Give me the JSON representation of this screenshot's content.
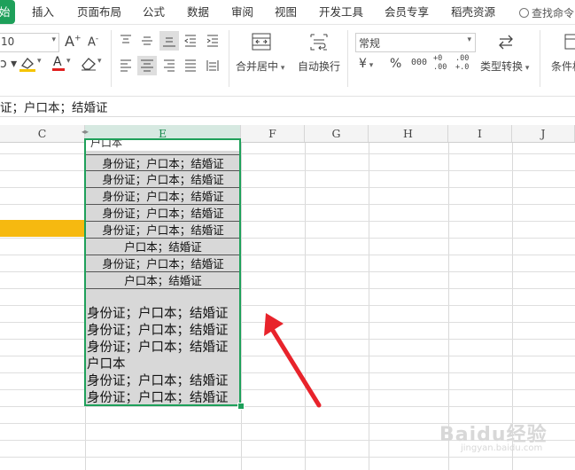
{
  "menu": {
    "tabs": [
      {
        "label": "始",
        "active": true
      },
      {
        "label": "插入"
      },
      {
        "label": "页面布局"
      },
      {
        "label": "公式"
      },
      {
        "label": "数据"
      },
      {
        "label": "审阅"
      },
      {
        "label": "视图"
      },
      {
        "label": "开发工具"
      },
      {
        "label": "会员专享"
      },
      {
        "label": "稻壳资源"
      }
    ],
    "search_label": "查找命令"
  },
  "ribbon": {
    "font_size": "10",
    "merge_center": "合并居中",
    "wrap_text": "自动换行",
    "number_format": "常规",
    "type_convert": "类型转换",
    "conditional": "条件格",
    "percent_symbol": "%",
    "thousands": "000",
    "inc_decimal": "+0 .00",
    "dec_decimal": ".00 +.0"
  },
  "formula_bar": {
    "text": "证；户口本；结婚证"
  },
  "columns": [
    "C",
    "E",
    "F",
    "G",
    "H",
    "I",
    "J"
  ],
  "selected_column": "E",
  "cells": {
    "partial_top": "户口本",
    "small_rows": [
      "身份证；户口本；结婚证",
      "身份证；户口本；结婚证",
      "身份证；户口本；结婚证",
      "身份证；户口本；结婚证",
      "身份证；户口本；结婚证",
      "户口本；结婚证",
      "身份证；户口本；结婚证",
      "户口本；结婚证"
    ],
    "big_rows": [
      "身份证；户口本；结婚证",
      "身份证；户口本；结婚证",
      "身份证；户口本；结婚证",
      "户口本",
      "身份证；户口本；结婚证",
      "身份证；户口本；结婚证"
    ]
  },
  "colors": {
    "accent": "#1ea05a",
    "highlight_cell": "#f6b910",
    "arrow": "#e8232b"
  },
  "watermark": {
    "text": "Baidu经验",
    "sub": "jingyan.baidu.com"
  }
}
